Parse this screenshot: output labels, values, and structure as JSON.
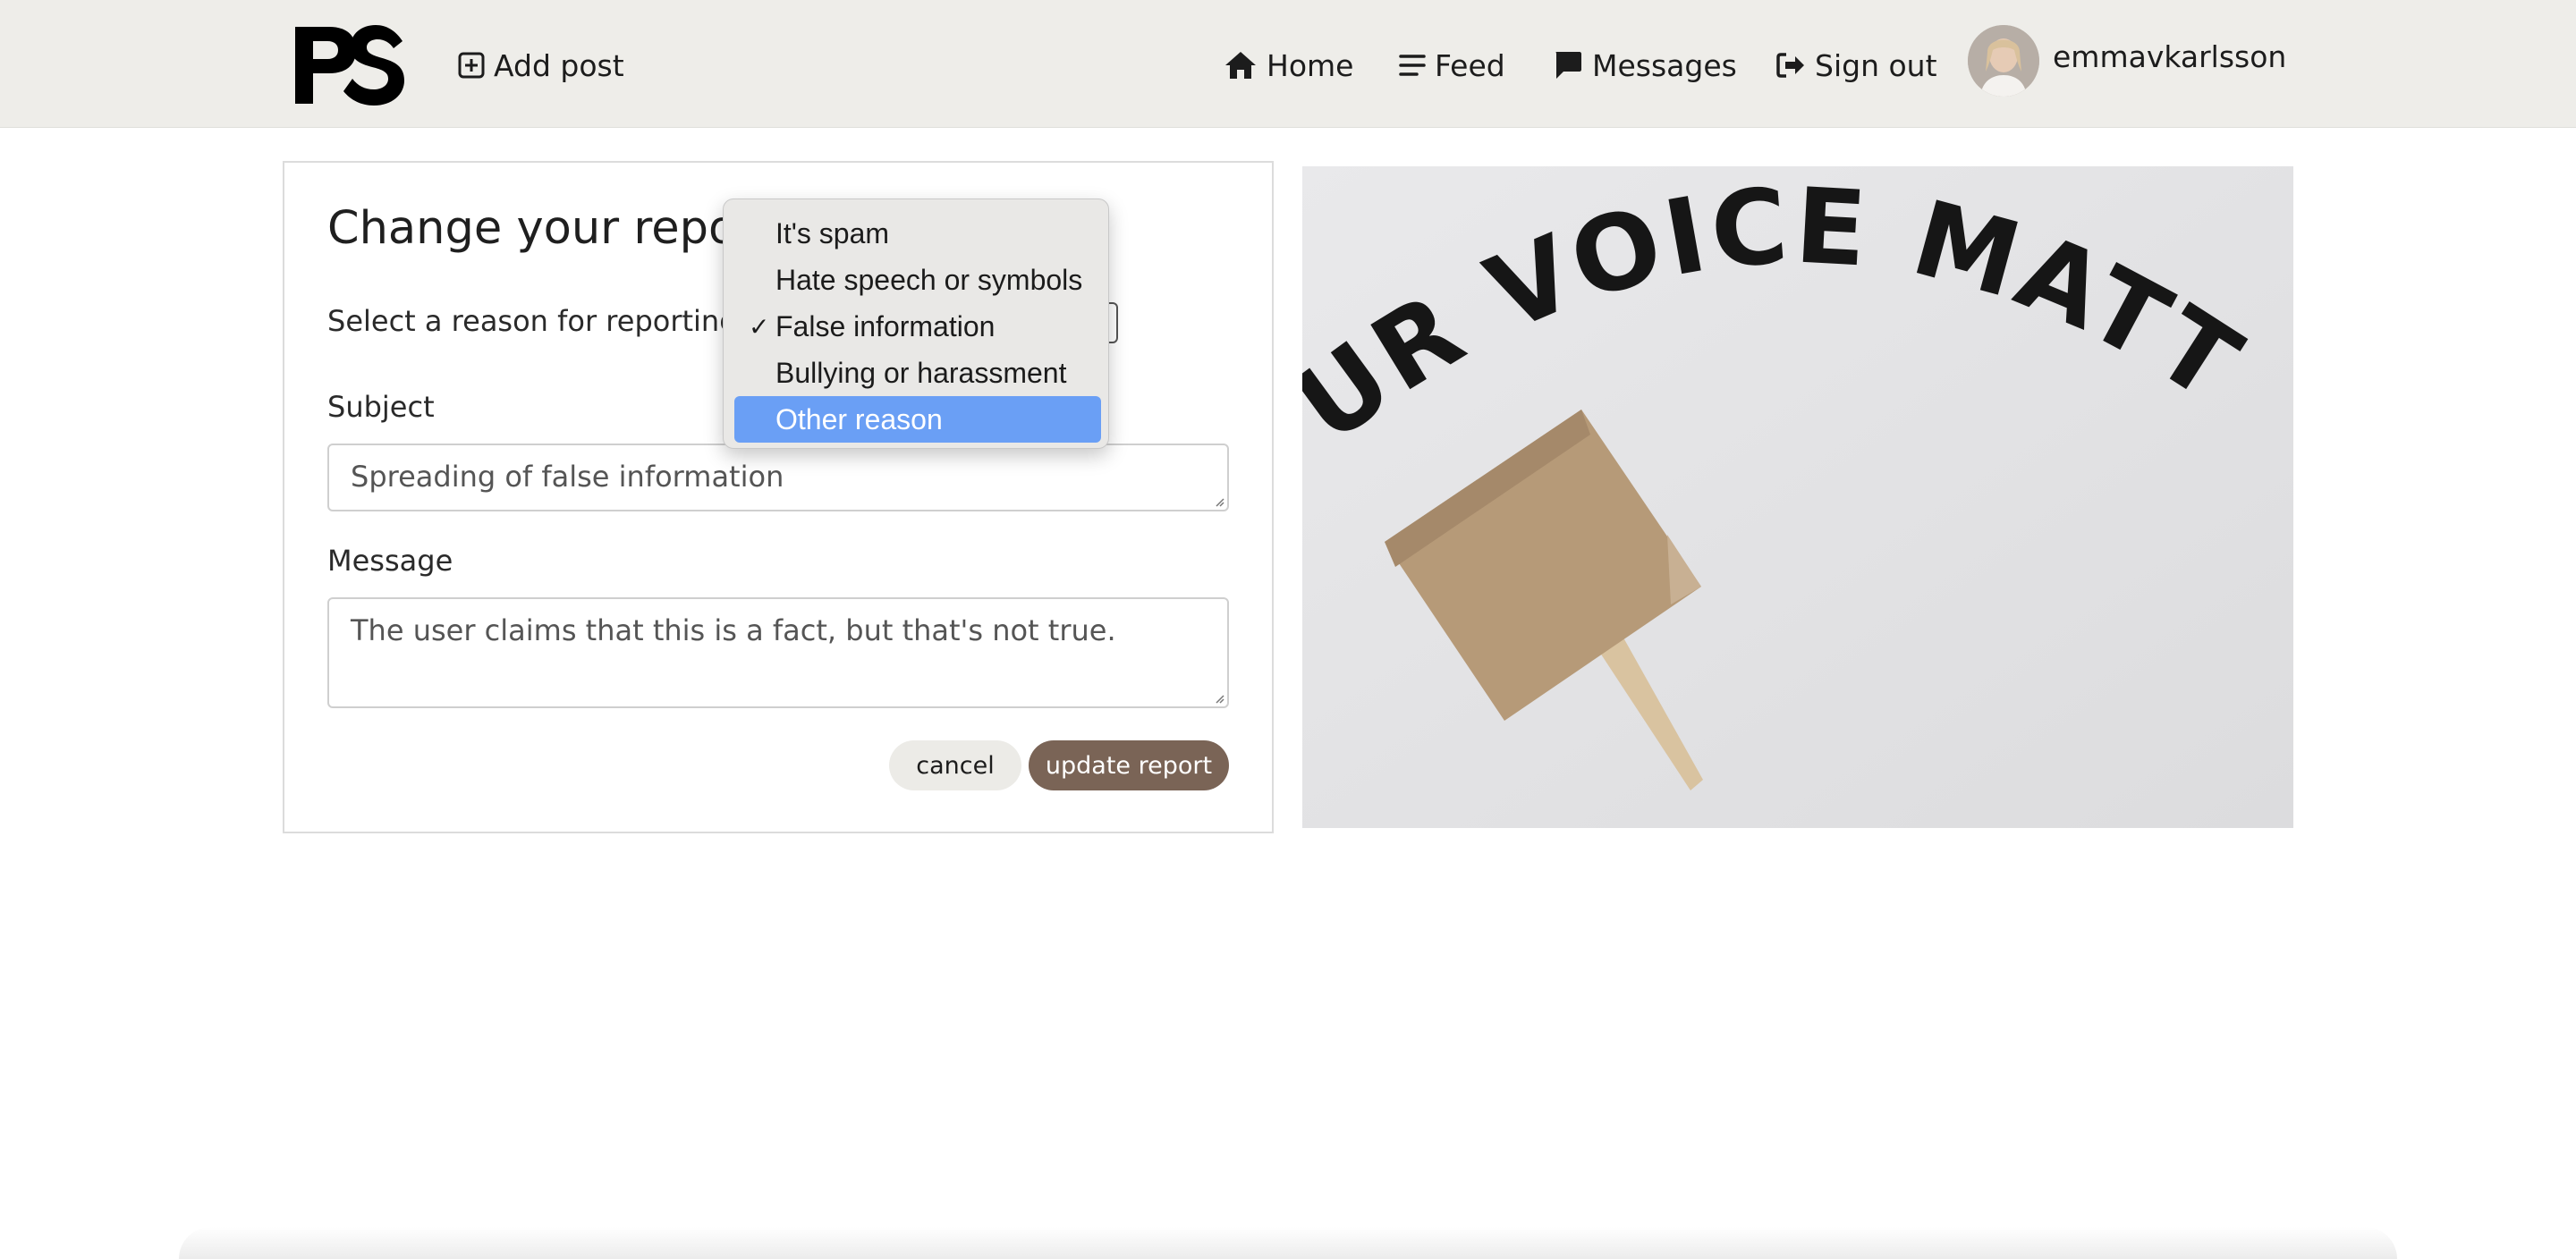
{
  "navbar": {
    "logo_text": "PS",
    "add_post": "Add post",
    "home": "Home",
    "feed": "Feed",
    "messages": "Messages",
    "sign_out": "Sign out",
    "username": "emmavkarlsson"
  },
  "form": {
    "title": "Change your report",
    "reason_label": "Select a reason for reporting",
    "selected_reason": "False information",
    "subject_label": "Subject",
    "subject_value": "Spreading of false information",
    "message_label": "Message",
    "message_value": "The user claims that this is a fact, but that's not true.",
    "cancel_label": "cancel",
    "update_label": "update report"
  },
  "dropdown": {
    "options": [
      {
        "label": "It's spam",
        "checked": false,
        "highlighted": false
      },
      {
        "label": "Hate speech or symbols",
        "checked": false,
        "highlighted": false
      },
      {
        "label": "False information",
        "checked": true,
        "highlighted": false
      },
      {
        "label": "Bullying or harassment",
        "checked": false,
        "highlighted": false
      },
      {
        "label": "Other reason",
        "checked": false,
        "highlighted": true
      }
    ]
  },
  "image": {
    "sign_text": "YOUR VOICE MATTERS"
  },
  "colors": {
    "navbar_bg": "#eeede9",
    "primary_button": "#7a6456",
    "highlight": "#6a9ff5"
  }
}
